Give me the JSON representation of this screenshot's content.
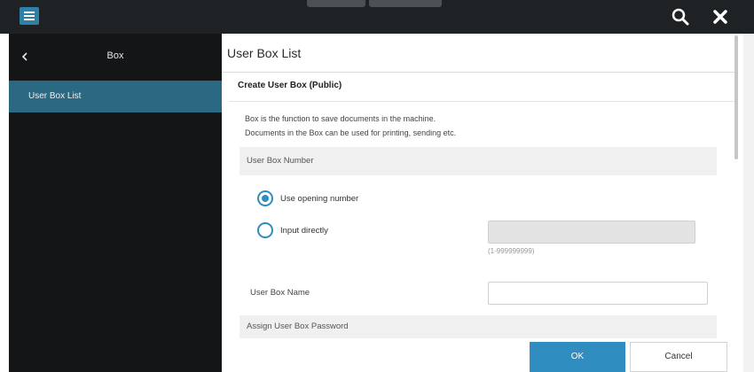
{
  "topbar": {
    "menu_icon": "hamburger-menu-icon",
    "search_icon": "search-icon",
    "close_icon": "close-icon"
  },
  "sidebar": {
    "back_icon": "chevron-left-icon",
    "title": "Box",
    "items": [
      {
        "label": "User Box List",
        "selected": true
      }
    ]
  },
  "main": {
    "page_title": "User Box List",
    "section_title": "Create User Box (Public)",
    "description_line1": "Box is the function to save documents in the machine.",
    "description_line2": "Documents in the Box can be used for printing, sending etc.",
    "user_box_number": {
      "heading": "User Box Number",
      "options": [
        {
          "label": "Use opening number",
          "checked": true
        },
        {
          "label": "Input directly",
          "checked": false
        }
      ],
      "input_value": "",
      "range_hint": "(1-999999999)"
    },
    "user_box_name": {
      "label": "User Box Name",
      "value": ""
    },
    "password_heading": "Assign User Box Password",
    "ok_label": "OK",
    "cancel_label": "Cancel"
  },
  "colors": {
    "accent": "#2f8dc0",
    "sidebar_bg": "#131516",
    "sidebar_selected": "#2b6881",
    "topbar_bg": "#1e2224"
  }
}
